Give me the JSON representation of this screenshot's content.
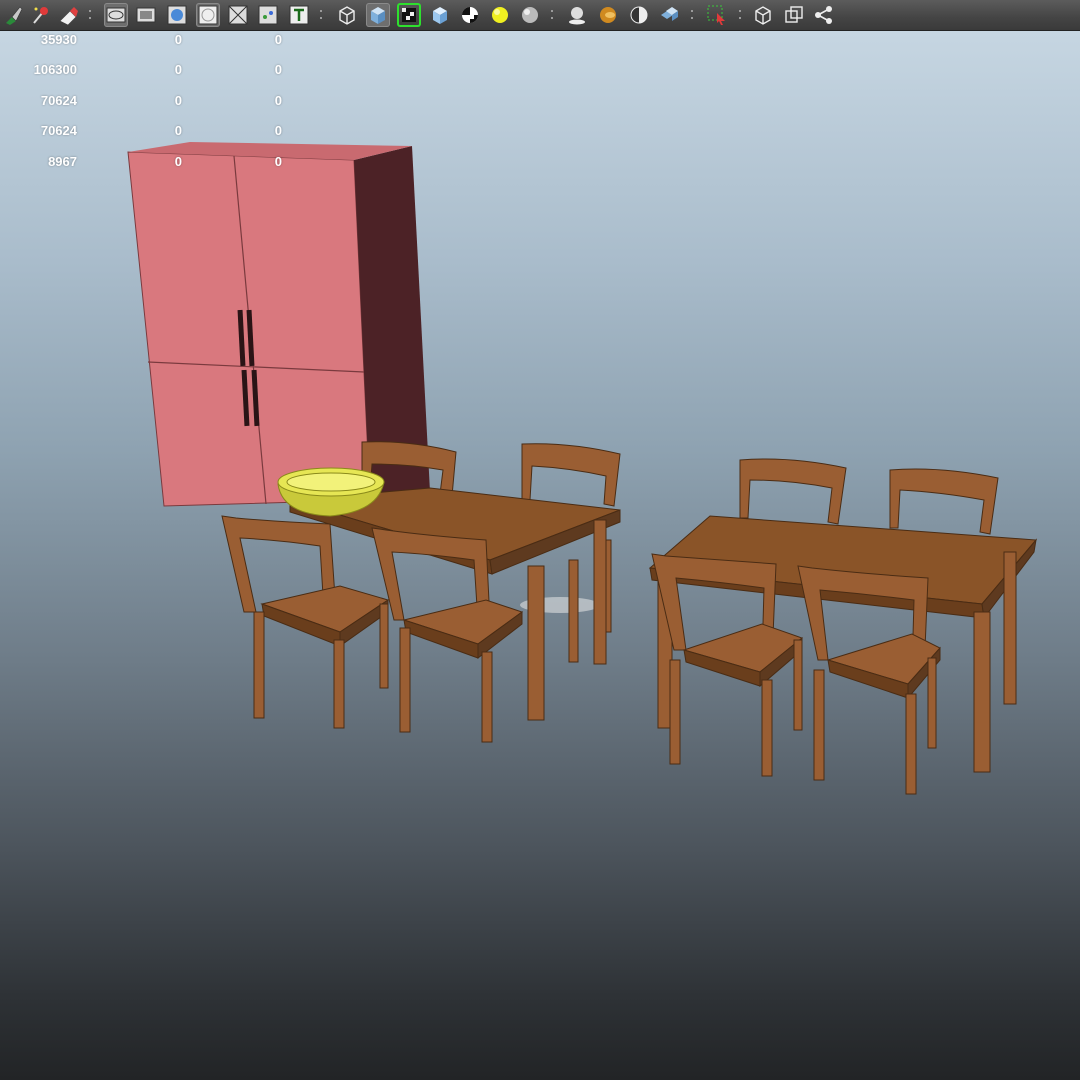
{
  "toolbar": {
    "icons": [
      "paint-tool-icon",
      "magic-wand-icon",
      "eraser-icon",
      "camera-view-icon",
      "film-gate-icon",
      "shaded-sphere-icon",
      "wireframe-circle-icon",
      "x-ray-icon",
      "uv-texture-icon",
      "text-label-icon",
      "wireframe-cube-icon",
      "smooth-shade-cube-icon",
      "wireframe-on-shaded-icon",
      "textured-cube-icon",
      "checker-texture-icon",
      "default-light-icon",
      "all-lights-icon",
      "shadow-icon",
      "ambient-occlusion-icon",
      "motion-blur-icon",
      "multisample-icon",
      "isolate-select-icon",
      "xray-joints-icon",
      "component-view-icon",
      "share-icon"
    ]
  },
  "hud": {
    "rows": [
      {
        "a": "35930",
        "b": "0",
        "c": "0"
      },
      {
        "a": "106300",
        "b": "0",
        "c": "0"
      },
      {
        "a": "70624",
        "b": "0",
        "c": "0"
      },
      {
        "a": "70624",
        "b": "0",
        "c": "0"
      },
      {
        "a": "8967",
        "b": "0",
        "c": "0"
      }
    ]
  },
  "colors": {
    "wardrobe_front": "#d9787e",
    "wardrobe_side": "#4c2226",
    "wood": "#9a5e33",
    "wood_dark": "#5e3a1f",
    "bowl": "#e6e654"
  }
}
